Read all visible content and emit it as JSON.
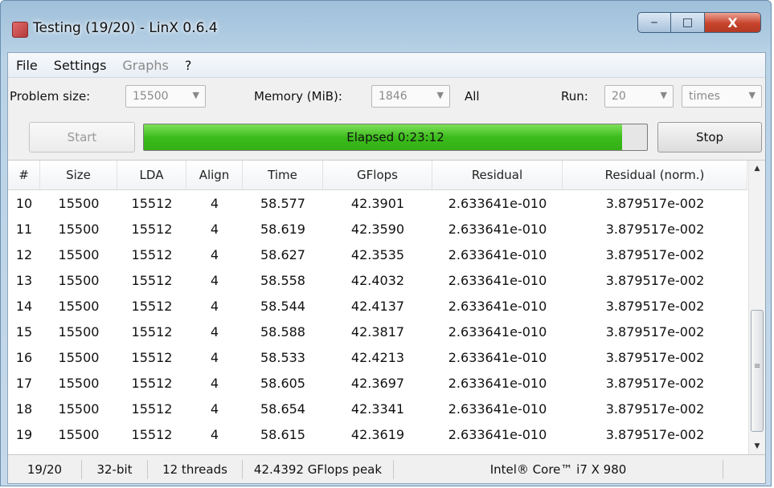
{
  "window": {
    "title": "Testing (19/20) - LinX 0.6.4",
    "buttons": {
      "minimize": "‒",
      "maximize": "□",
      "close": "X"
    }
  },
  "menu": [
    {
      "label": "File",
      "enabled": true
    },
    {
      "label": "Settings",
      "enabled": true
    },
    {
      "label": "Graphs",
      "enabled": false
    },
    {
      "label": "?",
      "enabled": true
    }
  ],
  "toolbar": {
    "problem_size_label": "Problem size:",
    "problem_size_value": "15500",
    "memory_label": "Memory (MiB):",
    "memory_value": "1846",
    "all_label": "All",
    "run_label": "Run:",
    "run_value": "20",
    "times_value": "times"
  },
  "actions": {
    "start_label": "Start",
    "stop_label": "Stop",
    "elapsed_text": "Elapsed 0:23:12",
    "progress_fraction": 0.95,
    "progress_color": "#3cbc1c"
  },
  "table": {
    "columns": [
      "#",
      "Size",
      "LDA",
      "Align",
      "Time",
      "GFlops",
      "Residual",
      "Residual (norm.)"
    ],
    "rows": [
      [
        "10",
        "15500",
        "15512",
        "4",
        "58.577",
        "42.3901",
        "2.633641e-010",
        "3.879517e-002"
      ],
      [
        "11",
        "15500",
        "15512",
        "4",
        "58.619",
        "42.3590",
        "2.633641e-010",
        "3.879517e-002"
      ],
      [
        "12",
        "15500",
        "15512",
        "4",
        "58.627",
        "42.3535",
        "2.633641e-010",
        "3.879517e-002"
      ],
      [
        "13",
        "15500",
        "15512",
        "4",
        "58.558",
        "42.4032",
        "2.633641e-010",
        "3.879517e-002"
      ],
      [
        "14",
        "15500",
        "15512",
        "4",
        "58.544",
        "42.4137",
        "2.633641e-010",
        "3.879517e-002"
      ],
      [
        "15",
        "15500",
        "15512",
        "4",
        "58.588",
        "42.3817",
        "2.633641e-010",
        "3.879517e-002"
      ],
      [
        "16",
        "15500",
        "15512",
        "4",
        "58.533",
        "42.4213",
        "2.633641e-010",
        "3.879517e-002"
      ],
      [
        "17",
        "15500",
        "15512",
        "4",
        "58.605",
        "42.3697",
        "2.633641e-010",
        "3.879517e-002"
      ],
      [
        "18",
        "15500",
        "15512",
        "4",
        "58.654",
        "42.3341",
        "2.633641e-010",
        "3.879517e-002"
      ],
      [
        "19",
        "15500",
        "15512",
        "4",
        "58.615",
        "42.3619",
        "2.633641e-010",
        "3.879517e-002"
      ]
    ]
  },
  "status": {
    "progress": "19/20",
    "arch": "32-bit",
    "threads": "12 threads",
    "peak": "42.4392 GFlops peak",
    "cpu": "Intel® Core™ i7 X 980"
  }
}
